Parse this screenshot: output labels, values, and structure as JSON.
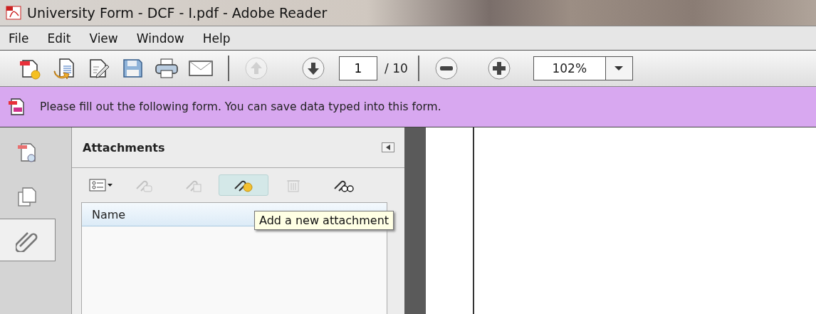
{
  "window": {
    "title": "University Form - DCF - I.pdf - Adobe Reader"
  },
  "menu": [
    "File",
    "Edit",
    "View",
    "Window",
    "Help"
  ],
  "toolbar": {
    "buttons": [
      {
        "disabled": false
      },
      {
        "disabled": false
      },
      {
        "disabled": false
      },
      {
        "disabled": false
      },
      {
        "disabled": false
      },
      {
        "disabled": false
      }
    ],
    "nav": [
      {
        "disabled": true
      },
      {
        "disabled": false
      }
    ],
    "page_number": "1",
    "page_total": "/ 10",
    "zoom": "102%"
  },
  "notice": {
    "text": "Please fill out the following form. You can save data typed into this form."
  },
  "nav_tabs": [
    {
      "selected": false
    },
    {
      "selected": false
    },
    {
      "selected": true
    }
  ],
  "attachments": {
    "title": "Attachments",
    "tools": [
      {
        "disabled": false,
        "hovered": false
      },
      {
        "disabled": true,
        "hovered": false
      },
      {
        "disabled": true,
        "hovered": false
      },
      {
        "disabled": false,
        "hovered": true
      },
      {
        "disabled": true,
        "hovered": false
      },
      {
        "disabled": false,
        "hovered": false
      }
    ],
    "columns": [
      "Name"
    ],
    "tooltip": "Add a new attachment"
  }
}
